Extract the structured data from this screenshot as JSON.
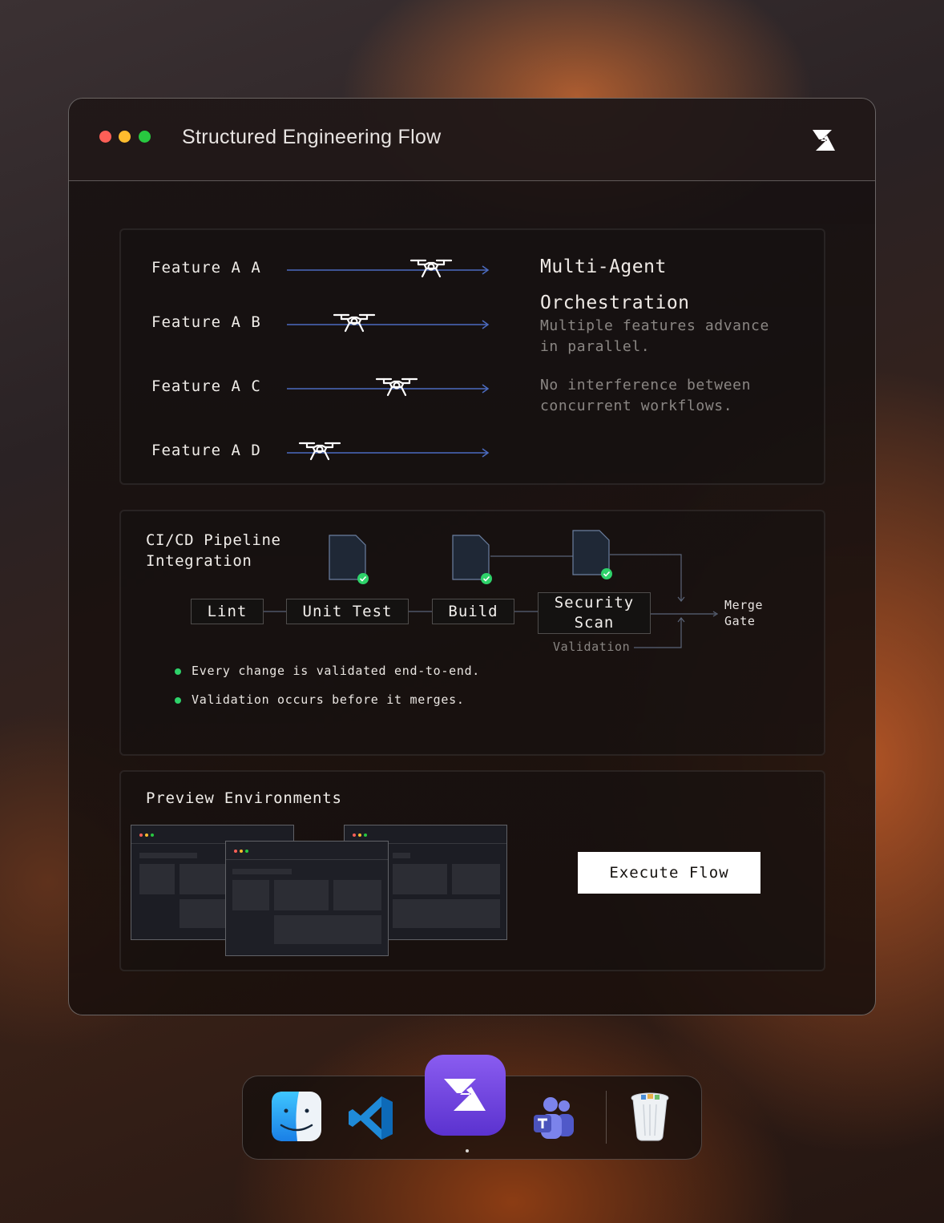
{
  "window": {
    "title": "Structured Engineering Flow",
    "logo_icon": "zed-logo-icon"
  },
  "orchestration": {
    "features": [
      {
        "label": "Feature A A",
        "progress": 0.71
      },
      {
        "label": "Feature A B",
        "progress": 0.33
      },
      {
        "label": "Feature A C",
        "progress": 0.54
      },
      {
        "label": "Feature A D",
        "progress": 0.16
      }
    ],
    "title_line1": "Multi-Agent",
    "title_line2": "Orchestration",
    "desc1_line1": "Multiple features advance",
    "desc1_line2": "in parallel.",
    "desc2_line1": "No interference between",
    "desc2_line2": "concurrent workflows."
  },
  "pipeline": {
    "title_line1": "CI/CD Pipeline",
    "title_line2": "Integration",
    "stages": {
      "lint": "Lint",
      "unit_test": "Unit Test",
      "build": "Build",
      "security_line1": "Security",
      "security_line2": "Scan"
    },
    "validation_label": "Validation",
    "merge_line1": "Merge",
    "merge_line2": "Gate",
    "bullets": [
      "Every change is validated end-to-end.",
      "Validation occurs before it merges."
    ],
    "status_color": "#2ed26a"
  },
  "preview": {
    "title": "Preview Environments",
    "execute_label": "Execute Flow"
  },
  "dock": {
    "apps": [
      "finder-icon",
      "vscode-icon",
      "zed-app-icon",
      "teams-icon",
      "trash-icon"
    ],
    "active_app": "zed-app-icon"
  },
  "colors": {
    "accent_purple": "#6c3fe0",
    "lane_line": "#4b6bbf"
  }
}
